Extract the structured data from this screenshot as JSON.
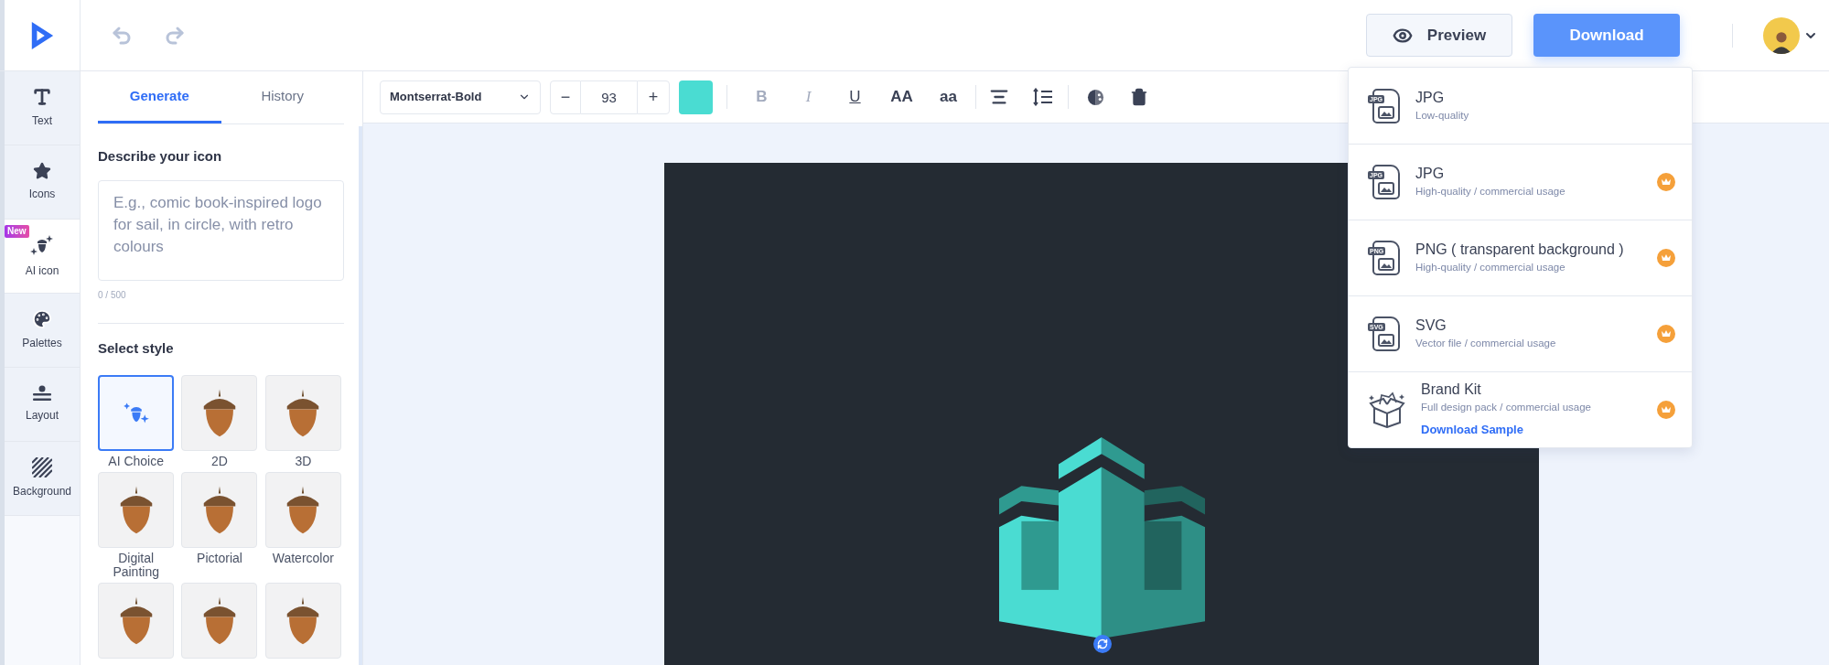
{
  "header": {
    "preview_button": "Preview",
    "download_button": "Download"
  },
  "rail": {
    "items": [
      {
        "kind": "text",
        "label": "Text",
        "selected": false
      },
      {
        "kind": "icons",
        "label": "Icons",
        "selected": false
      },
      {
        "kind": "ai_icon",
        "label": "AI icon",
        "badge": "New",
        "selected": true
      },
      {
        "kind": "palettes",
        "label": "Palettes",
        "selected": false
      },
      {
        "kind": "layout",
        "label": "Layout",
        "selected": false
      },
      {
        "kind": "background",
        "label": "Background",
        "selected": false
      }
    ]
  },
  "panel": {
    "tabs": [
      {
        "label": "Generate",
        "selected": true
      },
      {
        "label": "History",
        "selected": false
      }
    ],
    "describe_label": "Describe your icon",
    "prompt_placeholder": "E.g., comic book-inspired logo for sail, in circle, with retro colours",
    "counter": "0 / 500",
    "style_label": "Select style",
    "styles": [
      {
        "kind": "ai",
        "label": "AI Choice",
        "selected": true
      },
      {
        "kind": "image",
        "label": "2D",
        "selected": false
      },
      {
        "kind": "image",
        "label": "3D",
        "selected": false
      },
      {
        "kind": "image",
        "label": "Digital Painting",
        "selected": false
      },
      {
        "kind": "image",
        "label": "Pictorial",
        "selected": false
      },
      {
        "kind": "image",
        "label": "Watercolor",
        "selected": false
      },
      {
        "kind": "image",
        "selected": false
      },
      {
        "kind": "image",
        "selected": false
      },
      {
        "kind": "image",
        "selected": false
      }
    ]
  },
  "toolbar": {
    "font": "Montserrat-Bold",
    "decrease": "−",
    "size": "93",
    "increase": "+",
    "color": "#4adcd2",
    "format_buttons": [
      {
        "kind": "bold",
        "label": "B",
        "disabled": true
      },
      {
        "kind": "italic",
        "label": "I",
        "disabled": true
      },
      {
        "kind": "underline",
        "label": "U",
        "disabled": false
      },
      {
        "kind": "upper",
        "label": "AA",
        "disabled": false
      },
      {
        "kind": "lower",
        "label": "aa",
        "disabled": false
      }
    ]
  },
  "download_menu": {
    "items": [
      {
        "kind": "file",
        "file_type": "JPG",
        "title": "JPG",
        "subtitle": "Low-quality",
        "premium": false
      },
      {
        "kind": "file",
        "file_type": "JPG",
        "title": "JPG",
        "subtitle": "High-quality / commercial usage",
        "premium": true
      },
      {
        "kind": "file",
        "file_type": "PNG",
        "title": "PNG ( transparent background )",
        "subtitle": "High-quality / commercial usage",
        "premium": true
      },
      {
        "kind": "file",
        "file_type": "SVG",
        "title": "SVG",
        "subtitle": "Vector file / commercial usage",
        "premium": true
      },
      {
        "kind": "box",
        "title": "Brand Kit",
        "subtitle": "Full design pack / commercial usage",
        "link": "Download Sample",
        "premium": true
      }
    ]
  }
}
